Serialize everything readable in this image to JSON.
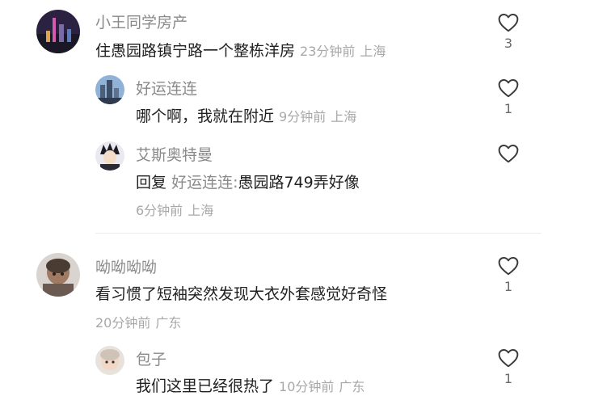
{
  "comments": [
    {
      "username": "小王同学房产",
      "text": "住愚园路镇宁路一个整栋洋房",
      "time": "23分钟前",
      "location": "上海",
      "likes": "3"
    },
    {
      "username": "好运连连",
      "text": "哪个啊，我就在附近",
      "time": "9分钟前",
      "location": "上海",
      "likes": "1"
    },
    {
      "username": "艾斯奥特曼",
      "reply_prefix": "回复",
      "reply_target": "好运连连:",
      "text": "愚园路749弄好像",
      "time": "6分钟前",
      "location": "上海",
      "likes": ""
    },
    {
      "username": "呦呦呦呦",
      "text": "看习惯了短袖突然发现大衣外套感觉好奇怪",
      "time": "20分钟前",
      "location": "广东",
      "likes": "1"
    },
    {
      "username": "包子",
      "text": "我们这里已经很热了",
      "time": "10分钟前",
      "location": "广东",
      "likes": "1"
    }
  ]
}
